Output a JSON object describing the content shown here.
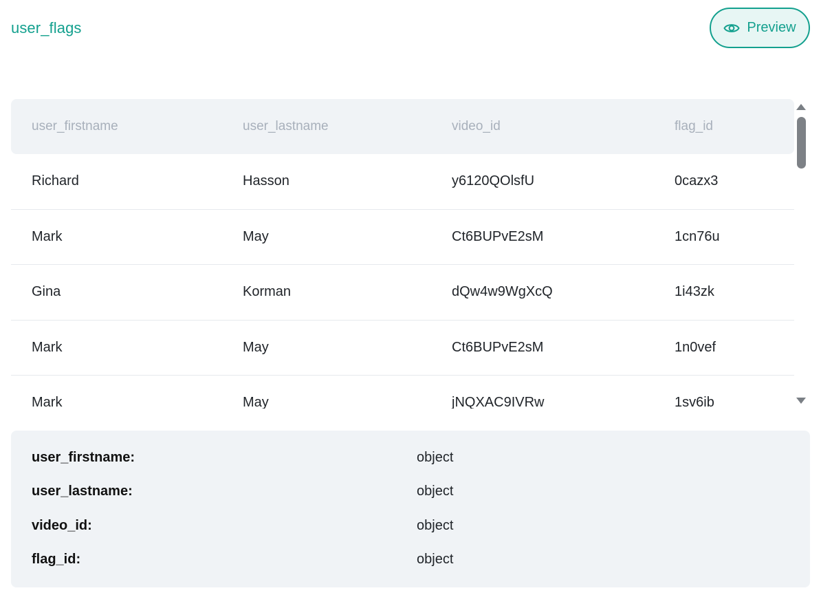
{
  "header": {
    "title": "user_flags",
    "preview_label": "Preview"
  },
  "table": {
    "columns": [
      "user_firstname",
      "user_lastname",
      "video_id",
      "flag_id"
    ],
    "rows": [
      [
        "Richard",
        "Hasson",
        "y6120QOlsfU",
        "0cazx3"
      ],
      [
        "Mark",
        "May",
        "Ct6BUPvE2sM",
        "1cn76u"
      ],
      [
        "Gina",
        "Korman",
        "dQw4w9WgXcQ",
        "1i43zk"
      ],
      [
        "Mark",
        "May",
        "Ct6BUPvE2sM",
        "1n0vef"
      ],
      [
        "Mark",
        "May",
        "jNQXAC9IVRw",
        "1sv6ib"
      ]
    ]
  },
  "schema": {
    "fields": [
      {
        "name": "user_firstname:",
        "type": "object"
      },
      {
        "name": "user_lastname:",
        "type": "object"
      },
      {
        "name": "video_id:",
        "type": "object"
      },
      {
        "name": "flag_id:",
        "type": "object"
      }
    ]
  },
  "icons": {
    "preview": "eye-icon"
  },
  "colors": {
    "accent": "#13a08e",
    "panel_bg": "#f0f3f6"
  }
}
